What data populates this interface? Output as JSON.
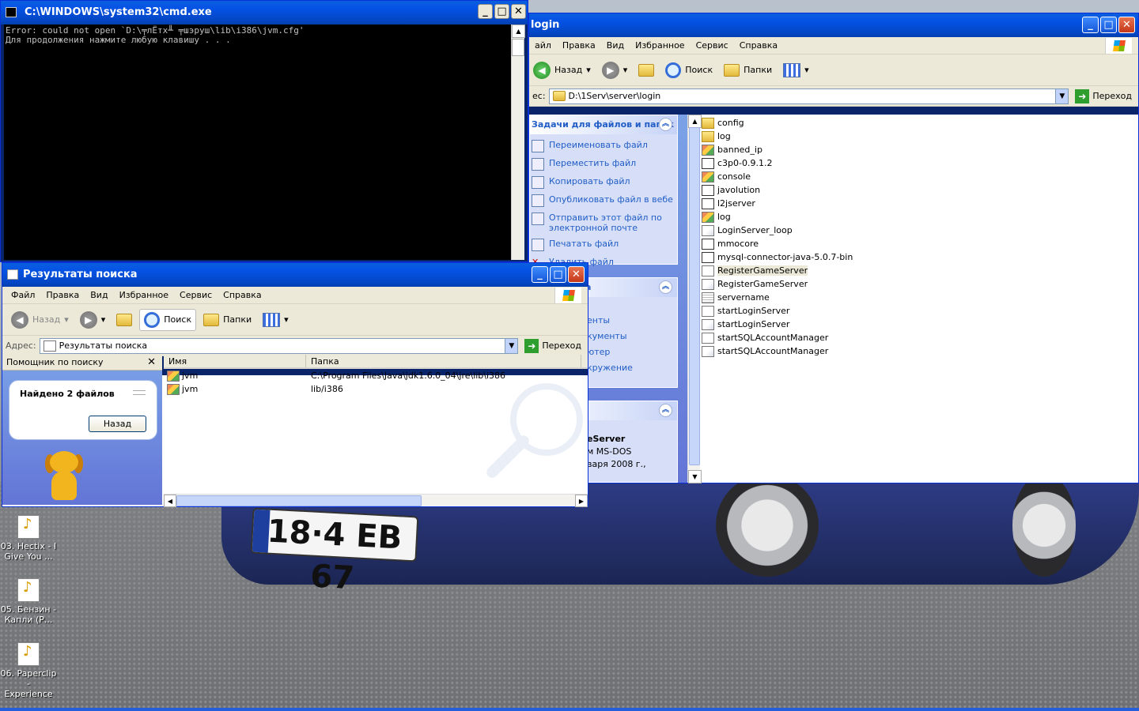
{
  "desktop": {
    "plate_text": "18·4 EB 67",
    "icons": [
      {
        "label": "03. Hectix - I Give You ...",
        "line1": "03. Hectix - I",
        "line2": "Give You ..."
      },
      {
        "label": "05. Бензин - Капли (Р...",
        "line1": "05. Бензин -",
        "line2": "Капли (Р..."
      },
      {
        "label": "06. Paperclip - Experience",
        "line1": "06. Paperclip -",
        "line2": "Experience"
      }
    ]
  },
  "cmd": {
    "title": "C:\\WINDOWS\\system32\\cmd.exe",
    "lines": [
      "Error: could not open `D:\\╤лЁтх╨ ╤шэруш\\lib\\i386\\jvm.cfg'",
      "Для продолжения нажмите любую клавишу . . ."
    ]
  },
  "login": {
    "title": "login",
    "menu": [
      "айл",
      "Правка",
      "Вид",
      "Избранное",
      "Сервис",
      "Справка"
    ],
    "toolbar": {
      "back": "Назад",
      "search": "Поиск",
      "folders": "Папки"
    },
    "address": {
      "label": "ес:",
      "value": "D:\\1Serv\\server\\login",
      "go": "Переход"
    },
    "taskpane": {
      "file_tasks_title": "Задачи для файлов и папок",
      "tasks": [
        {
          "label": "Переименовать файл",
          "icon": "rename-icon"
        },
        {
          "label": "Переместить файл",
          "icon": "move-icon"
        },
        {
          "label": "Копировать файл",
          "icon": "copy-icon"
        },
        {
          "label": "Опубликовать файл в вебе",
          "icon": "publish-icon"
        },
        {
          "label": "Отправить этот файл по электронной почте",
          "icon": "email-icon"
        },
        {
          "label": "Печатать файл",
          "icon": "print-icon"
        },
        {
          "label": "Удалить файл",
          "icon": "delete-icon"
        }
      ],
      "other_places_title": "а",
      "other_places": [
        "енты",
        "кументы",
        "ютер",
        "кружение"
      ],
      "details_title": "",
      "details_name": "eServer",
      "details_type": "м MS-DOS",
      "details_date": "варя 2008 г.,"
    },
    "files": [
      {
        "name": "config",
        "type": "folder"
      },
      {
        "name": "log",
        "type": "folder"
      },
      {
        "name": "banned_ip",
        "type": "log"
      },
      {
        "name": "c3p0-0.9.1.2",
        "type": "jar"
      },
      {
        "name": "console",
        "type": "log"
      },
      {
        "name": "javolution",
        "type": "jar"
      },
      {
        "name": "l2jserver",
        "type": "jar"
      },
      {
        "name": "log",
        "type": "log"
      },
      {
        "name": "LoginServer_loop",
        "type": "bat"
      },
      {
        "name": "mmocore",
        "type": "jar"
      },
      {
        "name": "mysql-connector-java-5.0.7-bin",
        "type": "jar"
      },
      {
        "name": "RegisterGameServer",
        "type": "cmd",
        "selected": true
      },
      {
        "name": "RegisterGameServer",
        "type": "bat"
      },
      {
        "name": "servername",
        "type": "cfg"
      },
      {
        "name": "startLoginServer",
        "type": "cmd"
      },
      {
        "name": "startLoginServer",
        "type": "bat"
      },
      {
        "name": "startSQLAccountManager",
        "type": "cmd"
      },
      {
        "name": "startSQLAccountManager",
        "type": "bat"
      }
    ]
  },
  "search": {
    "title": "Результаты поиска",
    "menu": [
      "Файл",
      "Правка",
      "Вид",
      "Избранное",
      "Сервис",
      "Справка"
    ],
    "toolbar": {
      "back": "Назад",
      "search": "Поиск",
      "folders": "Папки"
    },
    "address": {
      "label": "Адрес:",
      "value": "Результаты поиска",
      "go": "Переход"
    },
    "assistant": {
      "title": "Помощник по поиску",
      "found": "Найдено 2 файлов",
      "back": "Назад"
    },
    "columns": {
      "name": "Имя",
      "folder": "Папка"
    },
    "results": [
      {
        "name": "jvm",
        "folder": "C:\\Program Files\\Java\\jdk1.6.0_04\\jre\\lib\\i386"
      },
      {
        "name": "jvm",
        "folder": "lib/i386"
      }
    ]
  },
  "colors": {
    "titlebar": "#0553e5",
    "task_link": "#215dc6",
    "console_bg": "#000000",
    "console_fg": "#c0c0c0"
  }
}
